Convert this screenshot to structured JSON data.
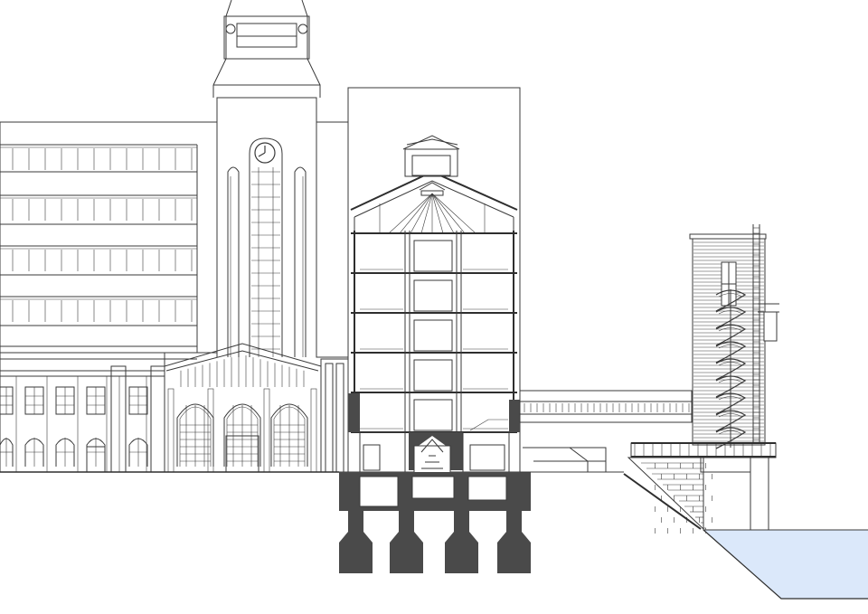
{
  "drawing": {
    "kind": "architectural section-elevation",
    "colors": {
      "line": "#3a3a3a",
      "cut": "#4a4a4a",
      "water": "#dbe8fa",
      "water_edge": "#2e2e2e",
      "background": "#ffffff"
    },
    "icons": [
      "clock-icon",
      "spiral-stair-icon",
      "ladder-icon",
      "arched-window-icon"
    ]
  }
}
